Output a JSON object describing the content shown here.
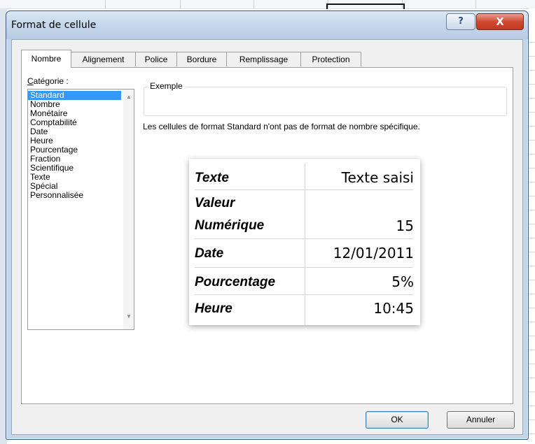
{
  "dialog": {
    "title": "Format de cellule",
    "help_button": "?",
    "close_button": "X"
  },
  "tabs": [
    {
      "label": "Nombre",
      "active": true
    },
    {
      "label": "Alignement",
      "active": false
    },
    {
      "label": "Police",
      "active": false
    },
    {
      "label": "Bordure",
      "active": false
    },
    {
      "label": "Remplissage",
      "active": false
    },
    {
      "label": "Protection",
      "active": false
    }
  ],
  "category": {
    "label_first_letter": "C",
    "label_rest": "atégorie :",
    "items": [
      "Standard",
      "Nombre",
      "Monétaire",
      "Comptabilité",
      "Date",
      "Heure",
      "Pourcentage",
      "Fraction",
      "Scientifique",
      "Texte",
      "Spécial",
      "Personnalisée"
    ],
    "selected": "Standard"
  },
  "example": {
    "label": "Exemple",
    "description": "Les cellules de format Standard n'ont pas de format de nombre spécifique."
  },
  "overlay_table": {
    "rows": [
      {
        "label": "Texte",
        "value": "Texte saisi"
      },
      {
        "label": "Valeur",
        "value": ""
      },
      {
        "label": "Numérique",
        "value": "15"
      },
      {
        "label": "Date",
        "value": "12/01/2011"
      },
      {
        "label": "Pourcentage",
        "value": "5%"
      },
      {
        "label": "Heure",
        "value": "10:45"
      }
    ]
  },
  "buttons": {
    "ok": "OK",
    "cancel": "Annuler"
  },
  "colors": {
    "selection": "#3399ff",
    "titlebar": "#c6d8ec",
    "close": "#c03a22"
  }
}
